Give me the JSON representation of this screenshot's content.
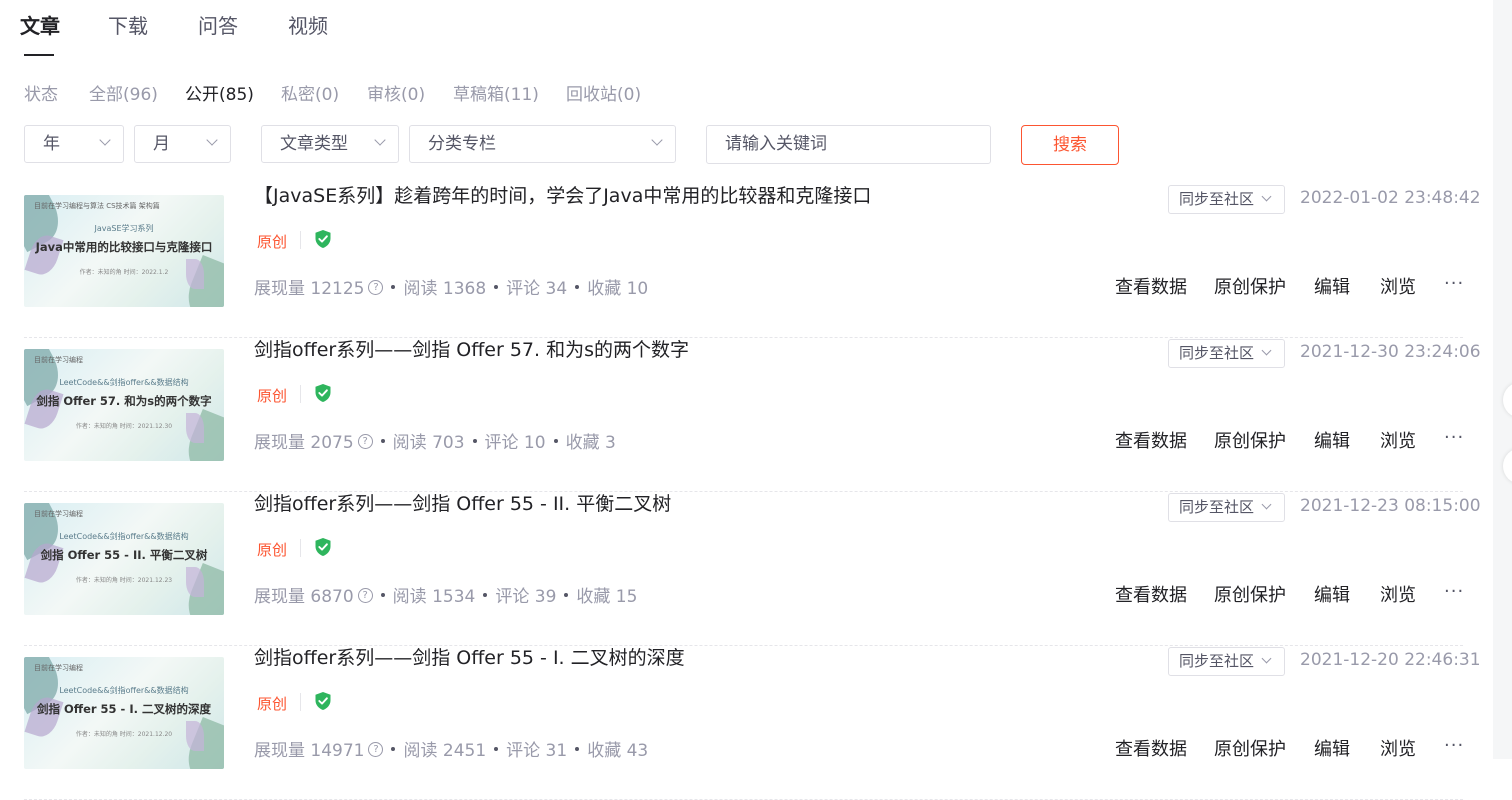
{
  "tabs": [
    {
      "label": "文章",
      "active": true
    },
    {
      "label": "下载",
      "active": false
    },
    {
      "label": "问答",
      "active": false
    },
    {
      "label": "视频",
      "active": false
    }
  ],
  "status": {
    "label": "状态",
    "items": [
      "全部(96)",
      "公开(85)",
      "私密(0)",
      "审核(0)",
      "草稿箱(11)",
      "回收站(0)"
    ],
    "active_index": 1
  },
  "filters": {
    "year": "年",
    "month": "月",
    "type": "文章类型",
    "category": "分类专栏",
    "keyword_placeholder": "请输入关键词",
    "search_label": "搜索"
  },
  "accent_color": "#fc5531",
  "original_color": "#2eb55d",
  "articles": [
    {
      "title": "【JavaSE系列】趁着跨年的时间，学会了Java中常用的比较器和克隆接口",
      "tag": "原创",
      "impressions": "展现量 12125",
      "reads": "阅读 1368",
      "comments": "评论 34",
      "favorites": "收藏 10",
      "sync": "同步至社区",
      "date": "2022-01-02 23:48:42",
      "thumb": {
        "top": "目前在学习编程与算法 CS技术篇 架构篇",
        "sub": "JavaSE学习系列",
        "main": "Java中常用的比较接口与克隆接口",
        "foot": "作者：未知的角 时间：2022.1.2"
      }
    },
    {
      "title": "剑指offer系列——剑指 Offer 57. 和为s的两个数字",
      "tag": "原创",
      "impressions": "展现量 2075",
      "reads": "阅读 703",
      "comments": "评论 10",
      "favorites": "收藏 3",
      "sync": "同步至社区",
      "date": "2021-12-30 23:24:06",
      "thumb": {
        "top": "目前在学习编程",
        "sub": "LeetCode&&剑指offer&&数据结构",
        "main": "剑指 Offer 57. 和为s的两个数字",
        "foot": "作者：未知的角 时间：2021.12.30"
      }
    },
    {
      "title": "剑指offer系列——剑指 Offer 55 - II. 平衡二叉树",
      "tag": "原创",
      "impressions": "展现量 6870",
      "reads": "阅读 1534",
      "comments": "评论 39",
      "favorites": "收藏 15",
      "sync": "同步至社区",
      "date": "2021-12-23 08:15:00",
      "thumb": {
        "top": "目前在学习编程",
        "sub": "LeetCode&&剑指offer&&数据结构",
        "main": "剑指 Offer 55 - II. 平衡二叉树",
        "foot": "作者：未知的角 时间：2021.12.23"
      }
    },
    {
      "title": "剑指offer系列——剑指 Offer 55 - I. 二叉树的深度",
      "tag": "原创",
      "impressions": "展现量 14971",
      "reads": "阅读 2451",
      "comments": "评论 31",
      "favorites": "收藏 43",
      "sync": "同步至社区",
      "date": "2021-12-20 22:46:31",
      "thumb": {
        "top": "目前在学习编程",
        "sub": "LeetCode&&剑指offer&&数据结构",
        "main": "剑指 Offer 55 - I. 二叉树的深度",
        "foot": "作者：未知的角 时间：2021.12.20"
      }
    }
  ],
  "actions": {
    "view_data": "查看数据",
    "protect": "原创保护",
    "edit": "编辑",
    "browse": "浏览",
    "more": "···"
  }
}
